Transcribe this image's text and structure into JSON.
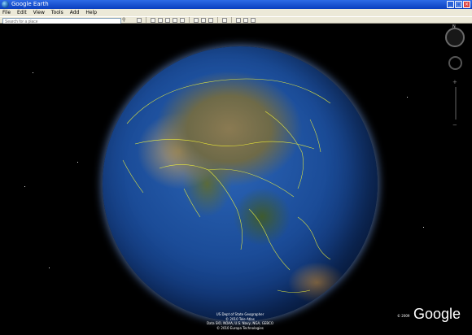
{
  "window": {
    "title": "Google Earth",
    "minimize": "_",
    "maximize": "□",
    "close": "×"
  },
  "menu": [
    "File",
    "Edit",
    "View",
    "Tools",
    "Add",
    "Help"
  ],
  "search": {
    "value": "",
    "placeholder": "Search for a place",
    "button_icon": "search-icon"
  },
  "toolbar": {
    "icons": [
      "sidebar-icon",
      "placemark-icon",
      "polygon-icon",
      "path-icon",
      "overlay-icon",
      "tour-icon",
      "sky-icon",
      "sun-icon",
      "historical-imagery-icon",
      "ruler-icon",
      "email-icon",
      "print-icon",
      "maps-icon"
    ]
  },
  "nav": {
    "north": "N",
    "zoom_in": "+",
    "zoom_out": "−"
  },
  "attribution": {
    "line1": "US Dept of State Geographer",
    "line2": "© 2010 Tele Atlas",
    "line3": "Data SIO, NOAA, U.S. Navy, NGA, GEBCO",
    "line4": "© 2010 Europa Technologies"
  },
  "copyright": "© 2009",
  "logo": "Google",
  "colors": {
    "titlebar": "#0a3fbf",
    "chrome": "#ece9d8",
    "borders": "#ffff33",
    "space": "#000000"
  }
}
